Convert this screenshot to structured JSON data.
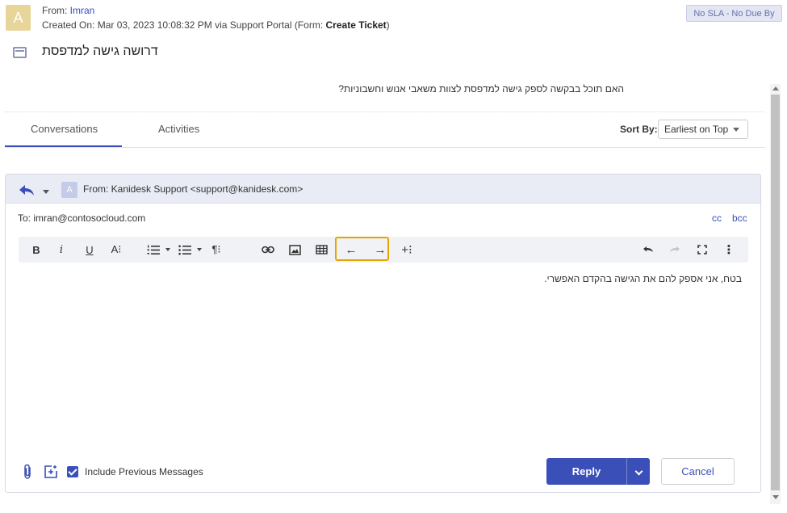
{
  "header": {
    "avatar_letter": "A",
    "from_prefix": "From: ",
    "from_name": "Imran",
    "created_prefix": "Created On: Mar 03, 2023 10:08:32 PM via Support Portal (Form: ",
    "created_form": "Create Ticket",
    "created_suffix": ")",
    "sla_badge": "No SLA - No Due By"
  },
  "ticket": {
    "subject": "דרושה גישה למדפסת",
    "question": "האם תוכל בבקשה לספק גישה למדפסת לצוות משאבי אנוש וחשבוניות?"
  },
  "tabs": [
    {
      "label": "Conversations",
      "active": true
    },
    {
      "label": "Activities",
      "active": false
    }
  ],
  "sort": {
    "label": "Sort By:",
    "value": "Earliest on Top"
  },
  "reply": {
    "avatar_letter": "A",
    "from": "From: Kanidesk Support <support@kanidesk.com>",
    "to": "To: imran@contosocloud.com",
    "cc": "cc",
    "bcc": "bcc",
    "body": "בטח, אני אספק להם את הגישה בהקדם האפשרי.",
    "include_previous": "Include Previous Messages",
    "include_checked": true,
    "reply_button": "Reply",
    "cancel_button": "Cancel"
  },
  "toolbar": {
    "bold": "B",
    "italic": "i",
    "underline": "U",
    "font_size": "A⁝",
    "paragraph": "¶⁝",
    "ltr_arrow": "←",
    "rtl_arrow": "→",
    "insert_more": "+⁝",
    "more": "⋮"
  },
  "colors": {
    "accent": "#3a4fb8",
    "highlight": "#e6a400",
    "avatar": "#e8d59a"
  }
}
